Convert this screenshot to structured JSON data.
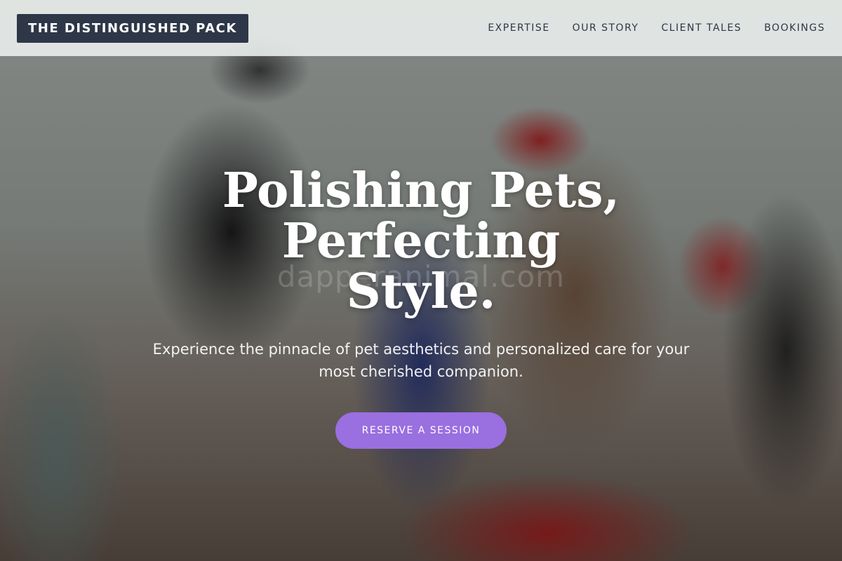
{
  "header": {
    "logo_text": "THE DISTINGUISHED PACK",
    "nav": [
      {
        "label": "EXPERTISE"
      },
      {
        "label": "OUR STORY"
      },
      {
        "label": "CLIENT TALES"
      },
      {
        "label": "BOOKINGS"
      }
    ]
  },
  "hero": {
    "title_line1": "Polishing Pets, Perfecting",
    "title_line2": "Style.",
    "subtitle_line1": "Experience the pinnacle of pet aesthetics and personalized care for your",
    "subtitle_line2": "most cherished companion.",
    "cta_label": "RESERVE A SESSION",
    "watermark": "dapperanimal.com"
  },
  "colors": {
    "header_bg": "#ecf0ee",
    "logo_bg": "#2d3748",
    "nav_text": "#2d3748",
    "cta_bg": "#9a6fe0",
    "text_light": "#ffffff"
  }
}
